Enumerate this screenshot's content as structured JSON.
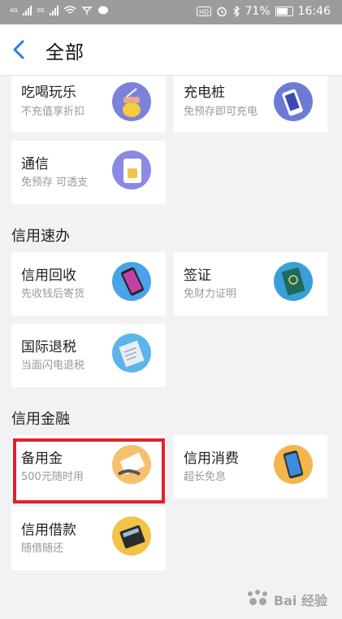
{
  "status_bar": {
    "signal1": "4G",
    "signal2": "3G",
    "battery": "71%",
    "time": "16:46"
  },
  "header": {
    "title": "全部"
  },
  "sections": [
    {
      "title": "",
      "items": [
        {
          "name": "吃喝玩乐",
          "desc": "不充值享折扣",
          "icon": "drink-icon"
        },
        {
          "name": "充电桩",
          "desc": "免预存即可充电",
          "icon": "powerbank-icon"
        },
        {
          "name": "通信",
          "desc": "免预存 可透支",
          "icon": "sim-card-icon"
        }
      ]
    },
    {
      "title": "信用速办",
      "items": [
        {
          "name": "信用回收",
          "desc": "先收钱后寄货",
          "icon": "phone-icon"
        },
        {
          "name": "签证",
          "desc": "免财力证明",
          "icon": "passport-icon"
        },
        {
          "name": "国际退税",
          "desc": "当面闪电退税",
          "icon": "receipt-icon"
        }
      ]
    },
    {
      "title": "信用金融",
      "items": [
        {
          "name": "备用金",
          "desc": "500元随时用",
          "icon": "card-in-hand-icon"
        },
        {
          "name": "信用消费",
          "desc": "超长免息",
          "icon": "phone-pay-icon"
        },
        {
          "name": "信用借款",
          "desc": "随借随还",
          "icon": "calculator-icon"
        }
      ]
    }
  ],
  "watermark": "Bai 经验",
  "colors": {
    "highlight": "#e0222a",
    "back_arrow": "#2a7fe0"
  }
}
